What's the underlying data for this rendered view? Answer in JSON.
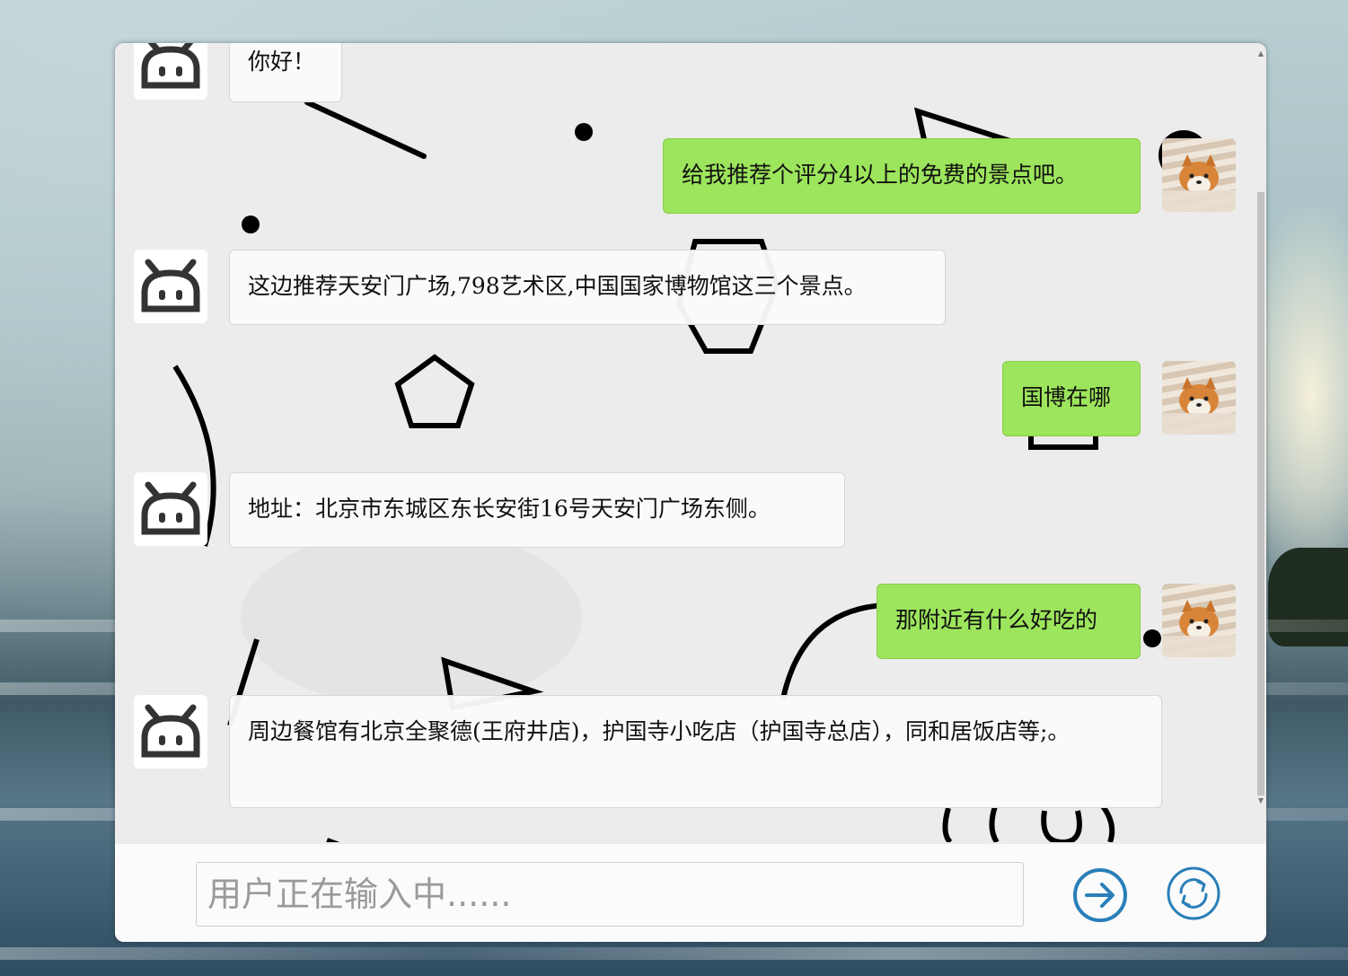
{
  "conversation": [
    {
      "role": "bot",
      "text": "你好！"
    },
    {
      "role": "user",
      "text": "给我推荐个评分4以上的免费的景点吧。"
    },
    {
      "role": "bot",
      "text": "这边推荐天安门广场,798艺术区,中国国家博物馆这三个景点。"
    },
    {
      "role": "user",
      "text": "国博在哪"
    },
    {
      "role": "bot",
      "text": "地址：北京市东城区东长安街16号天安门广场东侧。"
    },
    {
      "role": "user",
      "text": "那附近有什么好吃的"
    },
    {
      "role": "bot",
      "text": "周边餐馆有北京全聚德(王府井店)，护国寺小吃店（护国寺总店），同和居饭店等;。"
    }
  ],
  "input": {
    "placeholder": "用户正在输入中......"
  },
  "buttons": {
    "send_icon": "arrow-right-circle-icon",
    "refresh_icon": "refresh-circle-icon"
  },
  "colors": {
    "user_bubble": "#9de55c",
    "bot_bubble": "#fafafa",
    "icon_blue": "#2a7fb8"
  }
}
